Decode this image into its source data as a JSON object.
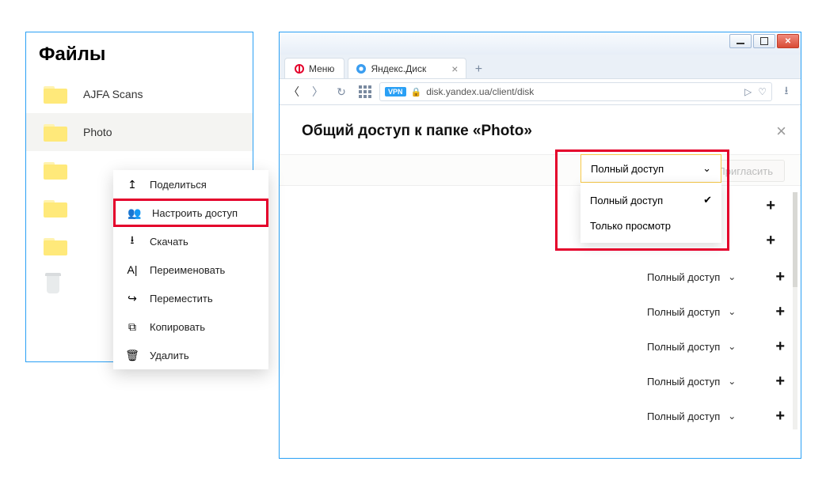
{
  "files_panel": {
    "title": "Файлы",
    "folders": [
      "AJFA Scans",
      "Photo",
      "",
      "",
      ""
    ],
    "context_menu": [
      {
        "icon": "share-icon",
        "label": "Поделиться",
        "glyph": "↥"
      },
      {
        "icon": "users-icon",
        "label": "Настроить доступ",
        "glyph": "👥",
        "highlight": true
      },
      {
        "icon": "download-icon",
        "label": "Скачать",
        "glyph": "⭳"
      },
      {
        "icon": "rename-icon",
        "label": "Переименовать",
        "glyph": "A|"
      },
      {
        "icon": "move-icon",
        "label": "Переместить",
        "glyph": "↪"
      },
      {
        "icon": "copy-icon",
        "label": "Копировать",
        "glyph": "⧉"
      },
      {
        "icon": "delete-icon",
        "label": "Удалить",
        "glyph": "🗑"
      }
    ]
  },
  "browser": {
    "menu_label": "Меню",
    "tab_title": "Яндекс.Диск",
    "url": "disk.yandex.ua/client/disk",
    "vpn": "VPN"
  },
  "dialog": {
    "title": "Общий доступ к папке «Photo»",
    "invite_label": "Пригласить",
    "dropdown": {
      "current": "Полный доступ",
      "options": [
        "Полный доступ",
        "Только просмотр"
      ]
    },
    "rows": [
      "Полный доступ",
      "Полный доступ",
      "Полный доступ",
      "Полный доступ",
      "Полный доступ"
    ]
  }
}
